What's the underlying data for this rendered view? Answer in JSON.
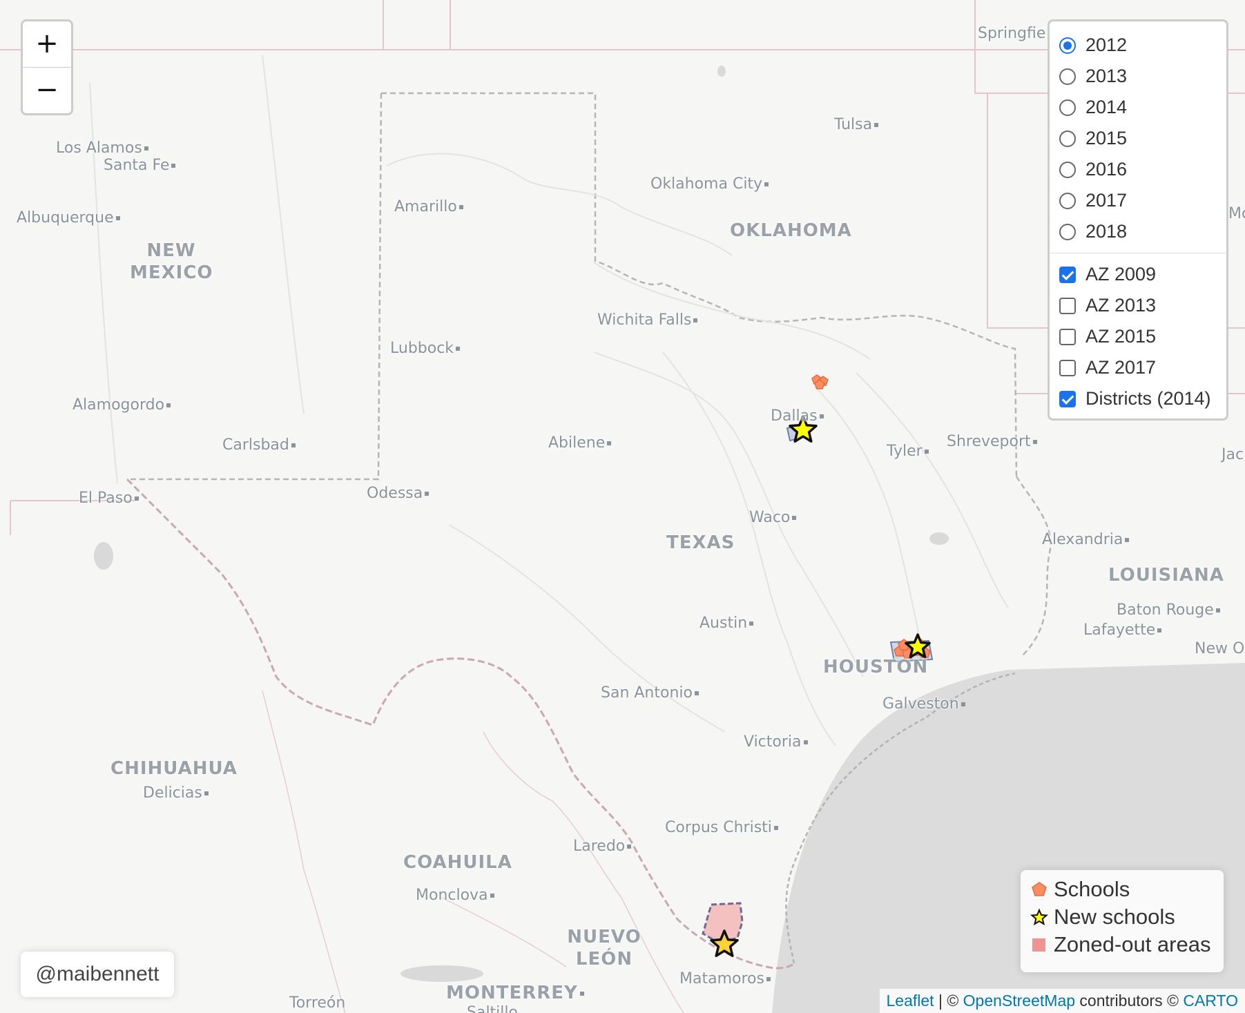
{
  "cities": [
    {
      "name": "Los Alamos"
    },
    {
      "name": "Santa Fe"
    },
    {
      "name": "Albuquerque"
    },
    {
      "name": "Amarillo"
    },
    {
      "name": "Oklahoma City"
    },
    {
      "name": "Tulsa"
    },
    {
      "name": "Springfie"
    },
    {
      "name": "Wichita Falls"
    },
    {
      "name": "Lubbock"
    },
    {
      "name": "Alamogordo"
    },
    {
      "name": "Carlsbad"
    },
    {
      "name": "Dallas"
    },
    {
      "name": "Abilene"
    },
    {
      "name": "Tyler"
    },
    {
      "name": "Shreveport"
    },
    {
      "name": "El Paso"
    },
    {
      "name": "Odessa"
    },
    {
      "name": "Waco"
    },
    {
      "name": "Alexandria"
    },
    {
      "name": "Austin"
    },
    {
      "name": "Baton Rouge"
    },
    {
      "name": "Lafayette"
    },
    {
      "name": "New O"
    },
    {
      "name": "San Antonio"
    },
    {
      "name": "Galveston"
    },
    {
      "name": "Victoria"
    },
    {
      "name": "Delicias"
    },
    {
      "name": "Corpus Christi"
    },
    {
      "name": "Laredo"
    },
    {
      "name": "Monclova"
    },
    {
      "name": "Matamoros"
    },
    {
      "name": "Torreón"
    },
    {
      "name": "Saltillo"
    },
    {
      "name": "Jac"
    },
    {
      "name": "Mo"
    }
  ],
  "regions": [
    {
      "name": "NEW MEXICO"
    },
    {
      "name": "OKLAHOMA"
    },
    {
      "name": "TEXAS"
    },
    {
      "name": "LOUISIANA"
    },
    {
      "name": "CHIHUAHUA"
    },
    {
      "name": "COAHUILA"
    },
    {
      "name": "NUEVO LEÓN"
    },
    {
      "name": "HOUSTON"
    },
    {
      "name": "MONTERREY"
    }
  ],
  "zoom": {
    "in": "+",
    "out": "−"
  },
  "layer_control": {
    "years": [
      {
        "label": "2012",
        "selected": true
      },
      {
        "label": "2013",
        "selected": false
      },
      {
        "label": "2014",
        "selected": false
      },
      {
        "label": "2015",
        "selected": false
      },
      {
        "label": "2016",
        "selected": false
      },
      {
        "label": "2017",
        "selected": false
      },
      {
        "label": "2018",
        "selected": false
      }
    ],
    "overlays": [
      {
        "label": "AZ 2009",
        "checked": true
      },
      {
        "label": "AZ 2013",
        "checked": false
      },
      {
        "label": "AZ 2015",
        "checked": false
      },
      {
        "label": "AZ 2017",
        "checked": false
      },
      {
        "label": "Districts (2014)",
        "checked": true
      }
    ]
  },
  "legend": {
    "schools": "Schools",
    "new_schools": "New schools",
    "zoned_out": "Zoned-out areas",
    "colors": {
      "schools": "#fc8d62",
      "new_schools": "#ffff00",
      "zoned_out": "#f08080"
    }
  },
  "credit": "@maibennett",
  "attribution": {
    "leaflet": "Leaflet",
    "sep1": " | © ",
    "osm": "OpenStreetMap",
    "mid": " contributors © ",
    "carto": "CARTO"
  }
}
